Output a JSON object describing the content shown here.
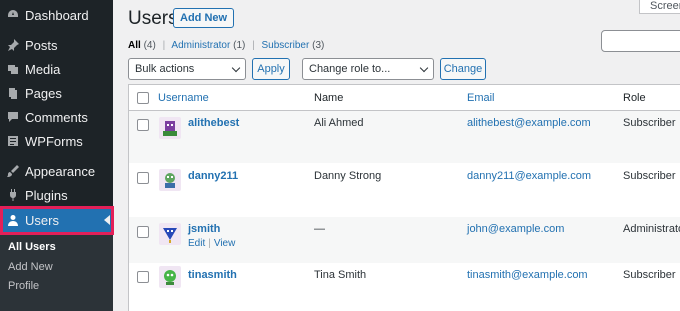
{
  "sidebar": {
    "items": [
      {
        "label": "Dashboard",
        "icon": "dashboard-icon"
      },
      {
        "label": "Posts",
        "icon": "pin-icon"
      },
      {
        "label": "Media",
        "icon": "media-icon"
      },
      {
        "label": "Pages",
        "icon": "pages-icon"
      },
      {
        "label": "Comments",
        "icon": "comment-icon"
      },
      {
        "label": "WPForms",
        "icon": "forms-icon"
      },
      {
        "label": "Appearance",
        "icon": "brush-icon"
      },
      {
        "label": "Plugins",
        "icon": "plug-icon"
      },
      {
        "label": "Users",
        "icon": "user-icon"
      }
    ],
    "submenu": [
      "All Users",
      "Add New",
      "Profile"
    ]
  },
  "header": {
    "title": "Users",
    "add_new": "Add New",
    "screen_options": "Screen"
  },
  "filters": {
    "all": "All",
    "all_count": "(4)",
    "administrator": "Administrator",
    "administrator_count": "(1)",
    "subscriber": "Subscriber",
    "subscriber_count": "(3)",
    "separator": "|"
  },
  "toolbar": {
    "bulk_actions": "Bulk actions",
    "apply": "Apply",
    "change_role": "Change role to...",
    "change": "Change"
  },
  "table": {
    "columns": [
      "Username",
      "Name",
      "Email",
      "Role"
    ],
    "rows": [
      {
        "username": "alithebest",
        "name": "Ali Ahmed",
        "email": "alithebest@example.com",
        "role": "Subscriber"
      },
      {
        "username": "danny211",
        "name": "Danny Strong",
        "email": "danny211@example.com",
        "role": "Subscriber"
      },
      {
        "username": "jsmith",
        "name": "—",
        "email": "john@example.com",
        "role": "Administrator",
        "actions": [
          "Edit",
          "View"
        ]
      },
      {
        "username": "tinasmith",
        "name": "Tina Smith",
        "email": "tinasmith@example.com",
        "role": "Subscriber"
      }
    ]
  },
  "colors": {
    "sidebar_bg": "#1d2327",
    "active_bg": "#2271b1",
    "highlight": "#e32059",
    "link": "#2271b1"
  }
}
